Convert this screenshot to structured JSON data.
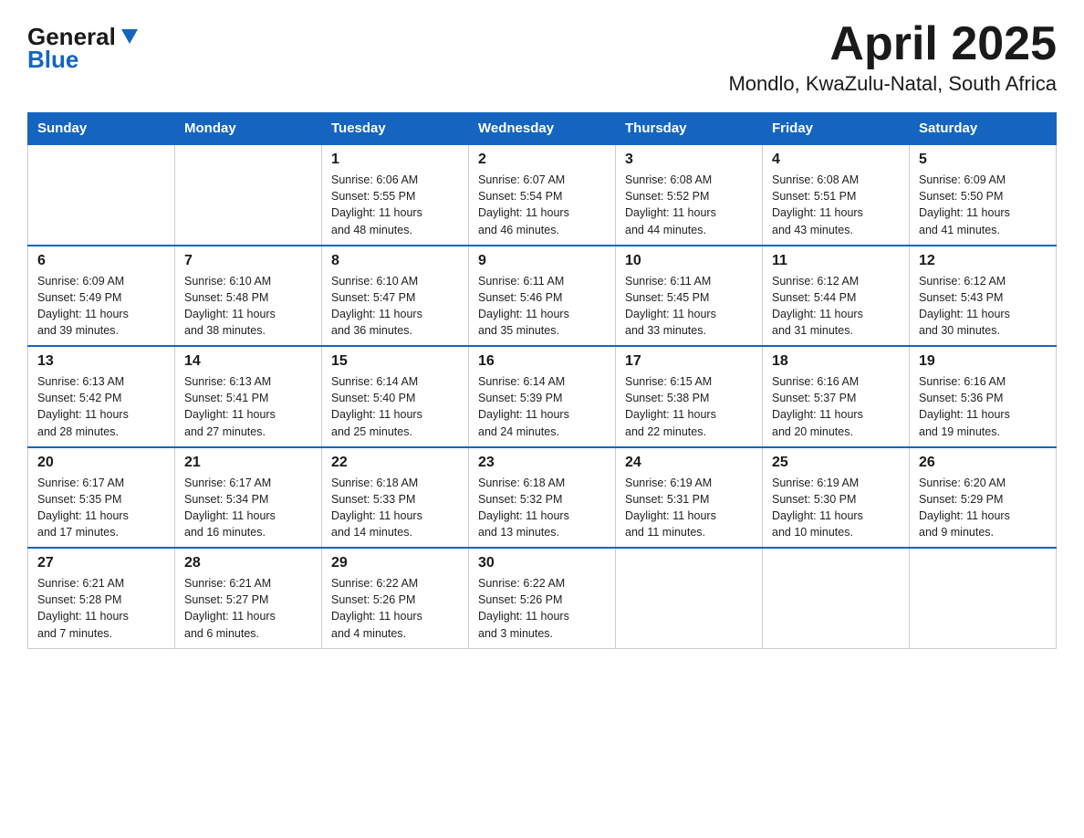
{
  "header": {
    "logo_general": "General",
    "logo_blue": "Blue",
    "title": "April 2025",
    "subtitle": "Mondlo, KwaZulu-Natal, South Africa"
  },
  "days_of_week": [
    "Sunday",
    "Monday",
    "Tuesday",
    "Wednesday",
    "Thursday",
    "Friday",
    "Saturday"
  ],
  "weeks": [
    [
      {
        "day": "",
        "info": ""
      },
      {
        "day": "",
        "info": ""
      },
      {
        "day": "1",
        "info": "Sunrise: 6:06 AM\nSunset: 5:55 PM\nDaylight: 11 hours\nand 48 minutes."
      },
      {
        "day": "2",
        "info": "Sunrise: 6:07 AM\nSunset: 5:54 PM\nDaylight: 11 hours\nand 46 minutes."
      },
      {
        "day": "3",
        "info": "Sunrise: 6:08 AM\nSunset: 5:52 PM\nDaylight: 11 hours\nand 44 minutes."
      },
      {
        "day": "4",
        "info": "Sunrise: 6:08 AM\nSunset: 5:51 PM\nDaylight: 11 hours\nand 43 minutes."
      },
      {
        "day": "5",
        "info": "Sunrise: 6:09 AM\nSunset: 5:50 PM\nDaylight: 11 hours\nand 41 minutes."
      }
    ],
    [
      {
        "day": "6",
        "info": "Sunrise: 6:09 AM\nSunset: 5:49 PM\nDaylight: 11 hours\nand 39 minutes."
      },
      {
        "day": "7",
        "info": "Sunrise: 6:10 AM\nSunset: 5:48 PM\nDaylight: 11 hours\nand 38 minutes."
      },
      {
        "day": "8",
        "info": "Sunrise: 6:10 AM\nSunset: 5:47 PM\nDaylight: 11 hours\nand 36 minutes."
      },
      {
        "day": "9",
        "info": "Sunrise: 6:11 AM\nSunset: 5:46 PM\nDaylight: 11 hours\nand 35 minutes."
      },
      {
        "day": "10",
        "info": "Sunrise: 6:11 AM\nSunset: 5:45 PM\nDaylight: 11 hours\nand 33 minutes."
      },
      {
        "day": "11",
        "info": "Sunrise: 6:12 AM\nSunset: 5:44 PM\nDaylight: 11 hours\nand 31 minutes."
      },
      {
        "day": "12",
        "info": "Sunrise: 6:12 AM\nSunset: 5:43 PM\nDaylight: 11 hours\nand 30 minutes."
      }
    ],
    [
      {
        "day": "13",
        "info": "Sunrise: 6:13 AM\nSunset: 5:42 PM\nDaylight: 11 hours\nand 28 minutes."
      },
      {
        "day": "14",
        "info": "Sunrise: 6:13 AM\nSunset: 5:41 PM\nDaylight: 11 hours\nand 27 minutes."
      },
      {
        "day": "15",
        "info": "Sunrise: 6:14 AM\nSunset: 5:40 PM\nDaylight: 11 hours\nand 25 minutes."
      },
      {
        "day": "16",
        "info": "Sunrise: 6:14 AM\nSunset: 5:39 PM\nDaylight: 11 hours\nand 24 minutes."
      },
      {
        "day": "17",
        "info": "Sunrise: 6:15 AM\nSunset: 5:38 PM\nDaylight: 11 hours\nand 22 minutes."
      },
      {
        "day": "18",
        "info": "Sunrise: 6:16 AM\nSunset: 5:37 PM\nDaylight: 11 hours\nand 20 minutes."
      },
      {
        "day": "19",
        "info": "Sunrise: 6:16 AM\nSunset: 5:36 PM\nDaylight: 11 hours\nand 19 minutes."
      }
    ],
    [
      {
        "day": "20",
        "info": "Sunrise: 6:17 AM\nSunset: 5:35 PM\nDaylight: 11 hours\nand 17 minutes."
      },
      {
        "day": "21",
        "info": "Sunrise: 6:17 AM\nSunset: 5:34 PM\nDaylight: 11 hours\nand 16 minutes."
      },
      {
        "day": "22",
        "info": "Sunrise: 6:18 AM\nSunset: 5:33 PM\nDaylight: 11 hours\nand 14 minutes."
      },
      {
        "day": "23",
        "info": "Sunrise: 6:18 AM\nSunset: 5:32 PM\nDaylight: 11 hours\nand 13 minutes."
      },
      {
        "day": "24",
        "info": "Sunrise: 6:19 AM\nSunset: 5:31 PM\nDaylight: 11 hours\nand 11 minutes."
      },
      {
        "day": "25",
        "info": "Sunrise: 6:19 AM\nSunset: 5:30 PM\nDaylight: 11 hours\nand 10 minutes."
      },
      {
        "day": "26",
        "info": "Sunrise: 6:20 AM\nSunset: 5:29 PM\nDaylight: 11 hours\nand 9 minutes."
      }
    ],
    [
      {
        "day": "27",
        "info": "Sunrise: 6:21 AM\nSunset: 5:28 PM\nDaylight: 11 hours\nand 7 minutes."
      },
      {
        "day": "28",
        "info": "Sunrise: 6:21 AM\nSunset: 5:27 PM\nDaylight: 11 hours\nand 6 minutes."
      },
      {
        "day": "29",
        "info": "Sunrise: 6:22 AM\nSunset: 5:26 PM\nDaylight: 11 hours\nand 4 minutes."
      },
      {
        "day": "30",
        "info": "Sunrise: 6:22 AM\nSunset: 5:26 PM\nDaylight: 11 hours\nand 3 minutes."
      },
      {
        "day": "",
        "info": ""
      },
      {
        "day": "",
        "info": ""
      },
      {
        "day": "",
        "info": ""
      }
    ]
  ]
}
